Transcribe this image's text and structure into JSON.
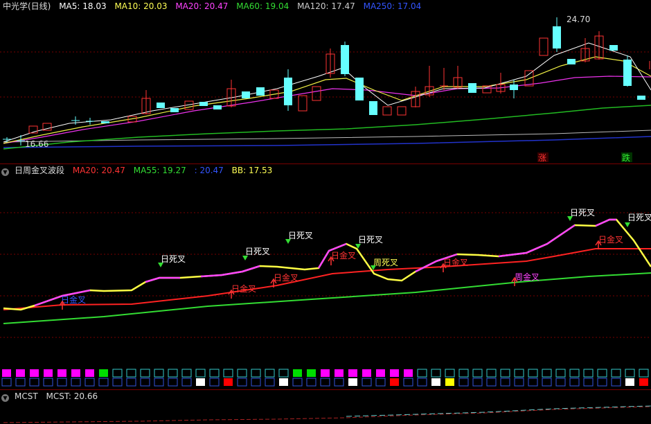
{
  "panel1": {
    "title": "中光学(日线)",
    "ma": [
      {
        "label": "MA5: 18.03",
        "color": "#ffffff"
      },
      {
        "label": "MA10: 20.03",
        "color": "#ffff55"
      },
      {
        "label": "MA20: 20.47",
        "color": "#ff44ff"
      },
      {
        "label": "MA60: 19.04",
        "color": "#33dd33"
      },
      {
        "label": "MA120: 17.47",
        "color": "#cccccc"
      },
      {
        "label": "MA250: 17.04",
        "color": "#3355ff"
      }
    ],
    "high_label": "24.70",
    "low_label": "16.66",
    "zhang": "涨",
    "die": "跌"
  },
  "panel2": {
    "title": "日周金叉波段",
    "ma": [
      {
        "label": "MA20: 20.47",
        "color": "#ff3333"
      },
      {
        "label": "MA55: 19.27",
        "color": "#33dd33"
      },
      {
        "label": ": 20.47",
        "color": "#3355ff"
      },
      {
        "label": "BB: 17.53",
        "color": "#ffff55"
      }
    ],
    "signals": [
      {
        "text": "日金叉",
        "color": "#3355ff",
        "arrow": "up"
      },
      {
        "text": "日死叉",
        "color": "#ffffff",
        "arrow": "down"
      },
      {
        "text": "日金叉",
        "color": "#ff3333",
        "arrow": "up"
      },
      {
        "text": "日死叉",
        "color": "#ffffff",
        "arrow": "down"
      },
      {
        "text": "日金叉",
        "color": "#ff3333",
        "arrow": "up"
      },
      {
        "text": "日死叉",
        "color": "#ffffff",
        "arrow": "down"
      },
      {
        "text": "日金叉",
        "color": "#ff3333",
        "arrow": "up"
      },
      {
        "text": "日死叉",
        "color": "#ffffff",
        "arrow": "down"
      },
      {
        "text": "周死叉",
        "color": "#ffff55",
        "arrow": "down"
      },
      {
        "text": "日金叉",
        "color": "#ff3333",
        "arrow": "up"
      },
      {
        "text": "周金叉",
        "color": "#ff44ff",
        "arrow": "up"
      },
      {
        "text": "日死叉",
        "color": "#ffffff",
        "arrow": "down"
      },
      {
        "text": "日金叉",
        "color": "#ff3333",
        "arrow": "up"
      },
      {
        "text": "日死叉",
        "color": "#ffffff",
        "arrow": "down"
      }
    ],
    "box_row1": [
      "M",
      "M",
      "M",
      "M",
      "M",
      "M",
      "M",
      "E",
      "E",
      "E",
      "E",
      "E",
      "E",
      "E",
      "E",
      "E",
      "E",
      "E",
      "E",
      "E",
      "E",
      "E",
      "E",
      "M",
      "M",
      "M",
      "M",
      "M",
      "M",
      "M",
      "E",
      "E",
      "E",
      "E",
      "E",
      "E",
      "E",
      "E",
      "E",
      "E",
      "E",
      "E",
      "E",
      "E",
      "E",
      "E",
      "E"
    ],
    "box_row2": [
      "E",
      "E",
      "E",
      "E",
      "E",
      "E",
      "E",
      "E",
      "E",
      "E",
      "E",
      "E",
      "E",
      "E",
      "W",
      "E",
      "R",
      "E",
      "E",
      "E",
      "W",
      "E",
      "E",
      "E",
      "E",
      "W",
      "E",
      "E",
      "R",
      "E",
      "E",
      "W",
      "Y",
      "E",
      "E",
      "E",
      "E",
      "E",
      "E",
      "E",
      "E",
      "E",
      "E",
      "E",
      "E",
      "W",
      "R",
      "Y",
      "E"
    ]
  },
  "panel3": {
    "title": "MCST",
    "value_label": "MCST: 20.66"
  }
}
